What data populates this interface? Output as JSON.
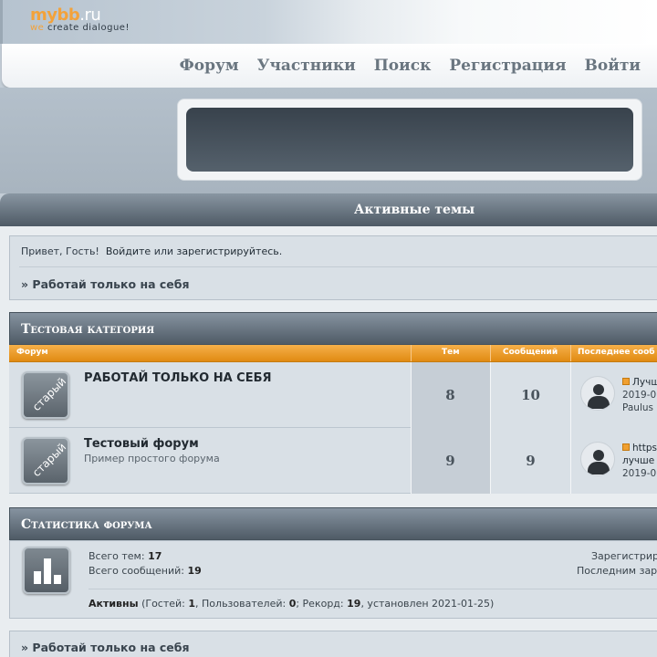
{
  "header": {
    "logo_main": "mybb",
    "logo_ru": ".ru",
    "logo_we": "we",
    "logo_tagline": "create dialogue!"
  },
  "nav": [
    "Форум",
    "Участники",
    "Поиск",
    "Регистрация",
    "Войти"
  ],
  "section_title": "Активные темы",
  "greeting": {
    "hello": "Привет, Гость!",
    "login": "Войдите",
    "or": "или",
    "register": "зарегистрируйтесь."
  },
  "crumb": "» Работай только на себя",
  "category": {
    "title": "Тестовая категория",
    "columns": [
      "Форум",
      "Тем",
      "Сообщений",
      "Последнее сооб"
    ],
    "forums": [
      {
        "icon_label": "старый",
        "name": "РАБОТАЙ ТОЛЬКО НА СЕБЯ",
        "description": "",
        "topics": "8",
        "posts": "10",
        "last": [
          "Лучш",
          "2019-0",
          "Paulus"
        ]
      },
      {
        "icon_label": "старый",
        "name": "Тестовый форум",
        "description": "Пример простого форума",
        "topics": "9",
        "posts": "9",
        "last": [
          "https",
          "лучше",
          "2019-0"
        ]
      }
    ]
  },
  "stats": {
    "title": "Статистика форума",
    "topics_label": "Всего тем:",
    "topics_value": "17",
    "posts_label": "Всего сообщений:",
    "posts_value": "19",
    "right1": "Зарегистрир",
    "right2": "Последним зар",
    "active_prefix": "Активны",
    "active_open": "(Гостей:",
    "guests": "1",
    "users_label": ", Пользователей:",
    "users": "0",
    "record_label": "; Рекорд:",
    "record": "19",
    "set_label": ", установлен 2021-01-25)"
  },
  "bottom_crumb": "» Работай только на себя",
  "colors": {
    "accent_orange": "#e08a12",
    "header_dark": "#4f5b66",
    "panel": "#d9e0e6"
  }
}
